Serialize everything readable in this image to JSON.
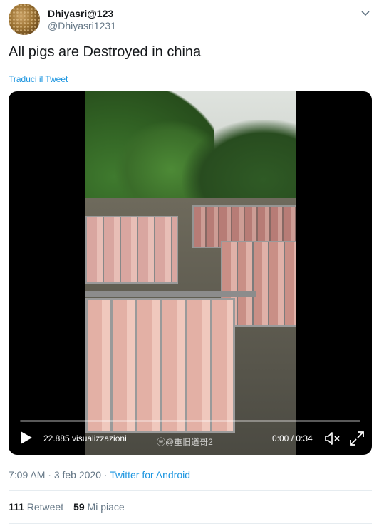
{
  "user": {
    "display_name": "Dhiyasri@123",
    "handle": "@Dhiyasri1231"
  },
  "tweet": {
    "text": "All pigs are Destroyed in china",
    "translate_label": "Traduci il Tweet"
  },
  "video": {
    "views": "22.885 visualizzazioni",
    "watermark": "ⓦ@重旧道哥2",
    "time": "0:00 / 0:34",
    "progress": 0
  },
  "meta": {
    "time": "7:09 AM",
    "separator1": " · ",
    "date": "3 feb 2020",
    "separator2": " · ",
    "client": "Twitter for Android"
  },
  "stats": {
    "retweets_count": "111",
    "retweets_label": "Retweet",
    "likes_count": "59",
    "likes_label": "Mi piace"
  },
  "colors": {
    "link": "#1b95e0",
    "secondary": "#657786",
    "text": "#14171a"
  }
}
